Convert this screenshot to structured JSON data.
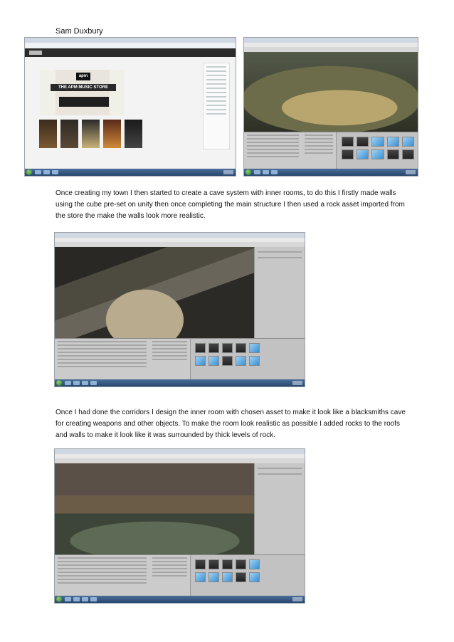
{
  "author": "Sam Duxbury",
  "paragraphs": [
    "Once creating my town I then started to create a cave system with inner rooms, to do this I firstly made walls using the cube pre-set on unity then once completing the main structure I then used a rock asset imported from the store the make the walls look more realistic.",
    "Once I had done the corridors I design the inner room with chosen asset to make it look like a blacksmiths cave for creating weapons and other objects. To make the room look realistic as possible I added rocks to the roofs and walls to make it look like it was surrounded by thick levels of rock."
  ],
  "screenshot1": {
    "banner_logo": "apm",
    "banner_title": "THE APM MUSIC STORE"
  },
  "colors": {
    "taskbar": "#27466e",
    "unity_panel": "#c2c2c2",
    "asset_cube": "#3a8fd0"
  }
}
